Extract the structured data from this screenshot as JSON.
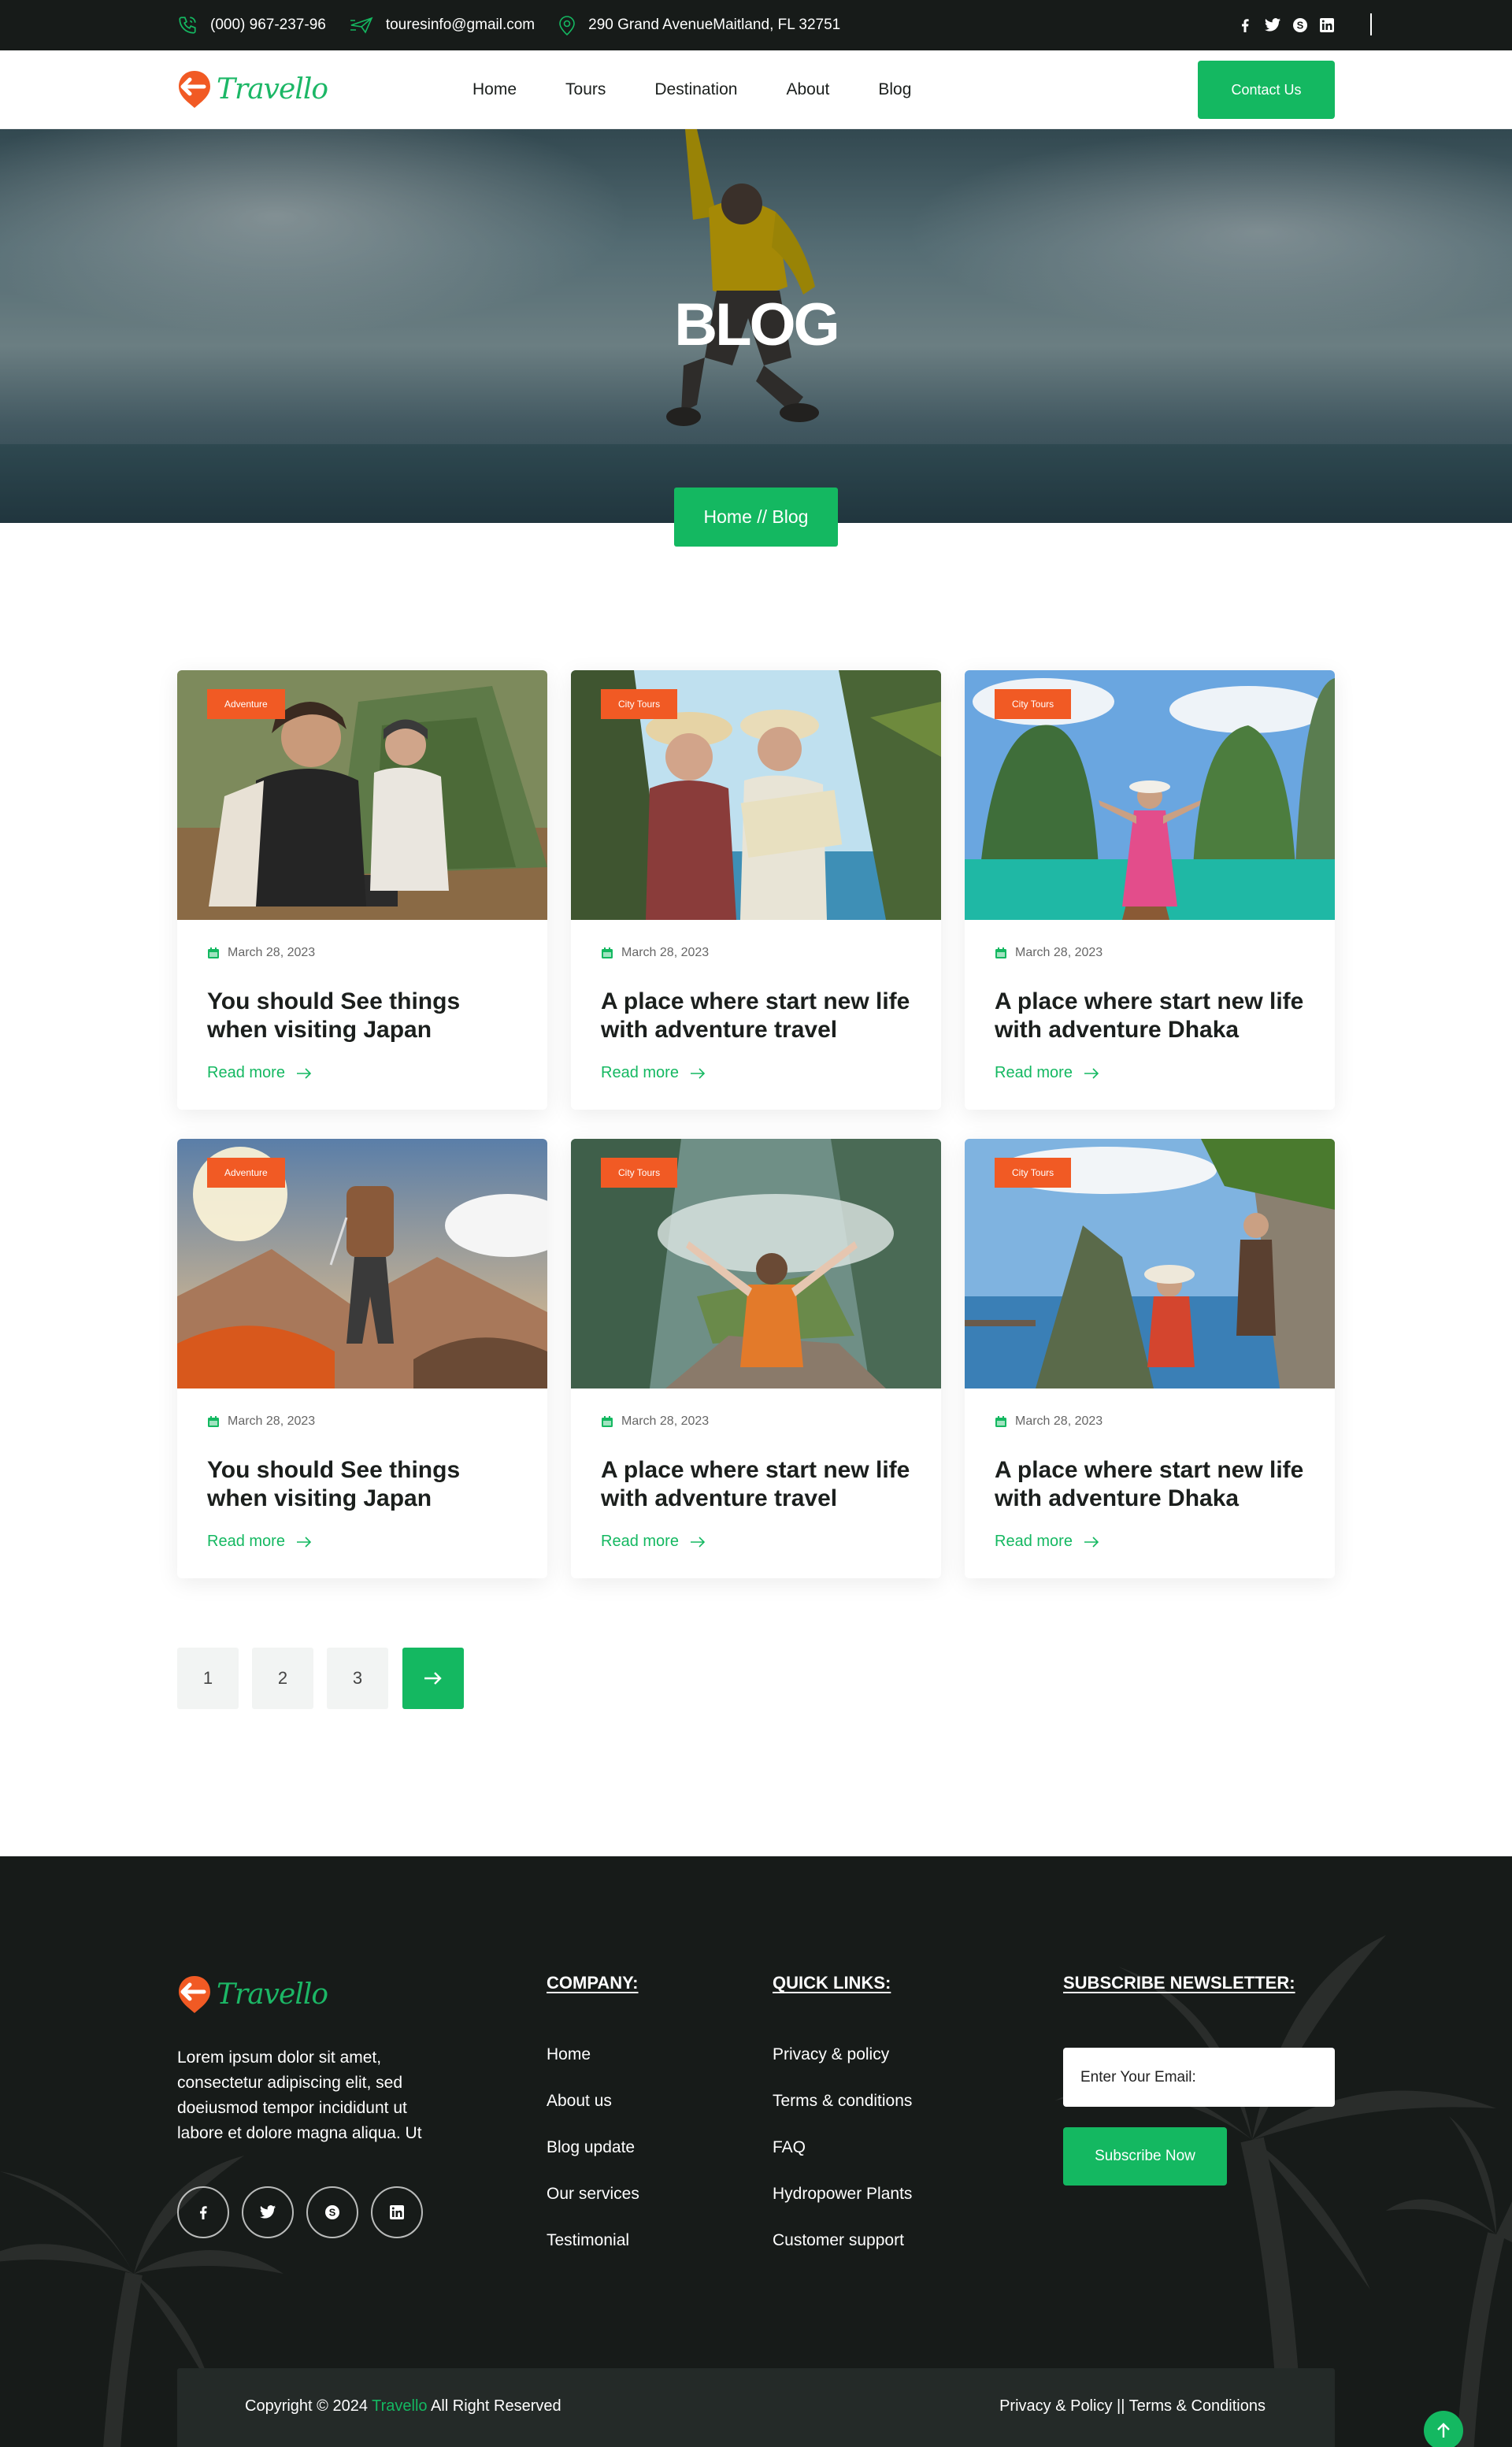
{
  "topbar": {
    "phone": "(000) 967-237-96",
    "email": "touresinfo@gmail.com",
    "address": "290 Grand AvenueMaitland, FL 32751",
    "social_icons": [
      "facebook-icon",
      "twitter-icon",
      "skype-icon",
      "linkedin-icon"
    ]
  },
  "header": {
    "logo_text": "Travello",
    "nav": [
      "Home",
      "Tours",
      "Destination",
      "About",
      "Blog"
    ],
    "contact_button": "Contact Us"
  },
  "hero": {
    "title": "BLOG",
    "breadcrumb": "Home // Blog"
  },
  "posts": [
    {
      "category": "Adventure",
      "date": "March 28, 2023",
      "title": "You should See things when visiting Japan",
      "link": "Read more"
    },
    {
      "category": "City Tours",
      "date": "March 28, 2023",
      "title": "A place where start new life with adventure travel",
      "link": "Read more"
    },
    {
      "category": "City Tours",
      "date": "March 28, 2023",
      "title": "A place where start new life with adventure Dhaka",
      "link": "Read more"
    },
    {
      "category": "Adventure",
      "date": "March 28, 2023",
      "title": "You should See things when visiting Japan",
      "link": "Read more"
    },
    {
      "category": "City Tours",
      "date": "March 28, 2023",
      "title": "A place where start new life with adventure travel",
      "link": "Read more"
    },
    {
      "category": "City Tours",
      "date": "March 28, 2023",
      "title": "A place where start new life with adventure Dhaka",
      "link": "Read more"
    }
  ],
  "pagination": {
    "pages": [
      "1",
      "2",
      "3"
    ],
    "current": "1"
  },
  "footer": {
    "logo_text": "Travello",
    "description": "Lorem ipsum dolor sit amet, consectetur adipiscing elit, sed doeiusmod tempor incididunt ut labore et dolore magna aliqua. Ut",
    "company_heading": "COMPANY:",
    "company_links": [
      "Home",
      "About us",
      "Blog update",
      "Our services",
      "Testimonial"
    ],
    "quick_heading": "QUICK LINKS:",
    "quick_links": [
      "Privacy & policy",
      "Terms & conditions",
      "FAQ",
      "Hydropower Plants",
      "Customer support"
    ],
    "newsletter_heading": "SUBSCRIBE NEWSLETTER:",
    "email_placeholder": "Enter Your Email:",
    "subscribe_button": "Subscribe Now",
    "copyright_prefix": "Copyright © 2024 ",
    "copyright_brand": "Travello",
    "copyright_suffix": " All Right Reserved",
    "bottom_links": "Privacy & Policy || Terms & Conditions"
  },
  "colors": {
    "accent": "#14b861",
    "badge": "#f15a24",
    "dark": "#171b19"
  }
}
